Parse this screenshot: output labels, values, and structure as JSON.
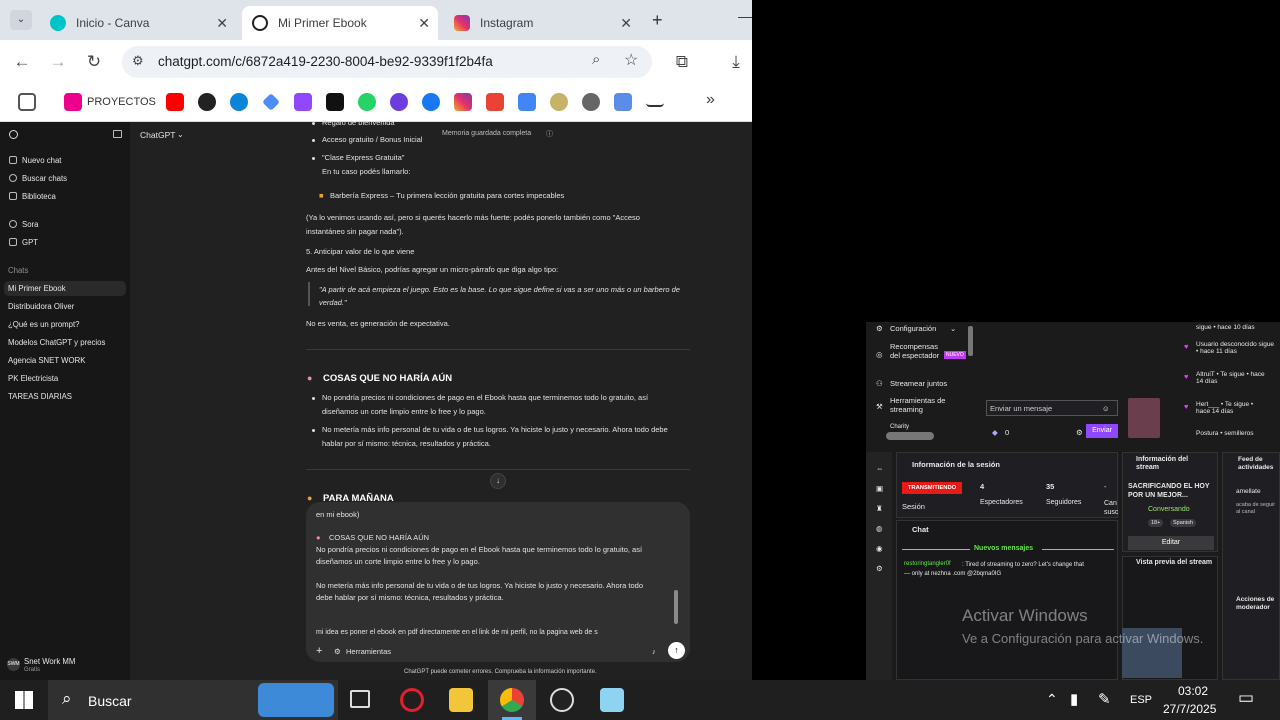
{
  "tabs": [
    {
      "label": "Inicio - Canva",
      "color": "#00c4cc"
    },
    {
      "label": "Mi Primer Ebook",
      "color": "#202020"
    },
    {
      "label": "Instagram",
      "color": "#e1306c"
    }
  ],
  "url": "chatgpt.com/c/6872a419-2230-8004-be92-9339f1f2b4fa",
  "bookmarks": {
    "proyectos": "PROYECTOS"
  },
  "sidebar": {
    "nav": [
      "Nuevo chat",
      "Buscar chats",
      "Biblioteca",
      "Sora",
      "GPT"
    ],
    "chats_header": "Chats",
    "chats": [
      "Mi Primer Ebook",
      "Distribuidora Oliver",
      "¿Qué es un prompt?",
      "Modelos ChatGPT y precios",
      "Agencia SNET WORK",
      "PK Electricista",
      "TAREAS DIARIAS"
    ],
    "user": "Snet Work MM",
    "plan": "Gratis",
    "avatar": "SWM"
  },
  "header": {
    "model": "ChatGPT",
    "memory": "Memoria guardada completa"
  },
  "conv": {
    "l1": "Regalo de bienvenida",
    "l2": "Acceso gratuito / Bonus Inicial",
    "l3": "\"Clase Express Gratuita\"",
    "l4": "En tu caso podés llamarlo:",
    "l5": "Barbería Express – Tu primera lección gratuita para cortes impecables",
    "l6": "(Ya lo venimos usando así, pero si querés hacerlo más fuerte: podés ponerlo también como \"Acceso",
    "l7": "instantáneo sin pagar nada\").",
    "l8": "5. Anticipar valor de lo que viene",
    "l9": "Antes del Nivel Básico, podrías agregar un micro-párrafo que diga algo tipo:",
    "l10": "\"A partir de acá empieza el juego. Esto es la base. Lo que sigue define si vas a ser uno más o un barbero de",
    "l11": "verdad.\"",
    "l12": "No es venta, es generación de expectativa.",
    "h1": "COSAS QUE NO HARÍA AÚN",
    "b1a": "No pondría precios ni condiciones de pago en el Ebook hasta que terminemos todo lo gratuito, así",
    "b1b": "diseñamos un corte limpio entre lo free y lo pago.",
    "b2a": "No metería más info personal de tu vida o de tus logros. Ya hiciste lo justo y necesario. Ahora todo debe",
    "b2b": "hablar por sí mismo: técnica, resultados y práctica.",
    "h2": "PARA MAÑANA"
  },
  "composer": {
    "p0": "en mi ebook)",
    "p1": "COSAS QUE NO HARÍA AÚN",
    "p2": "No pondría precios ni condiciones de pago en el Ebook hasta que terminemos todo lo gratuito, así",
    "p3": "diseñamos un corte limpio entre lo free y lo pago.",
    "p4": "No metería más info personal de tu vida o de tus logros. Ya hiciste lo justo y necesario. Ahora todo",
    "p5": "debe hablar por sí mismo: técnica, resultados y práctica.",
    "p6": "mi idea es poner el ebook en pdf directamente en el link de mi perfil, no la pagina web de s",
    "tools": "Herramientas",
    "disclaimer": "ChatGPT puede cometer errores. Comprueba la información importante."
  },
  "obs": {
    "menu": [
      "Configuración",
      "Recompensas del espectador",
      "Streamear juntos",
      "Herramientas de streaming",
      "Charity"
    ],
    "badge": "NUEVO",
    "send_placeholder": "Enviar un mensaje",
    "send": "Enviar",
    "count": "0",
    "activity": [
      {
        "t": "sigue • hace 10 días"
      },
      {
        "t": "Usuario desconocido sigue • hace 11 días"
      },
      {
        "t": "AltruiT • Te sigue • hace 14 días"
      },
      {
        "t": "Hert___ • Te sigue • hace 14 días"
      },
      {
        "t": "Postura • semilleros"
      }
    ],
    "session_title": "Información de la sesión",
    "live": "TRANSMITIENDO",
    "session": "Sesión",
    "viewers": "4",
    "viewers_label": "Espectadores",
    "followers": "35",
    "followers_label": "Seguidores",
    "subs_label": "Can susc",
    "subs_value": "-",
    "stream_info": "Información del stream",
    "stream_title": "SACRIFICANDO EL HOY POR UN MEJOR...",
    "category": "Conversando",
    "tag1": "18+",
    "tag2": "Spanish",
    "edit": "Editar",
    "feed": "Feed de actividades",
    "feed_user": "amellate",
    "feed_text": "acaba de seguir al canal",
    "chat": "Chat",
    "new_messages": "Nuevos mensajes",
    "chat_user": "restoringtangler0f",
    "chat_msg": ": Tired of streaming to zero? Let's change that — only at nezhna .com @2bqma0IG",
    "preview": "Vista previa del stream",
    "mod_actions": "Acciones de moderador",
    "watermark1": "Activar Windows",
    "watermark2": "Ve a Configuración para activar Windows."
  },
  "taskbar": {
    "search": "Buscar",
    "lang": "ESP",
    "time": "03:02",
    "date": "27/7/2025"
  }
}
